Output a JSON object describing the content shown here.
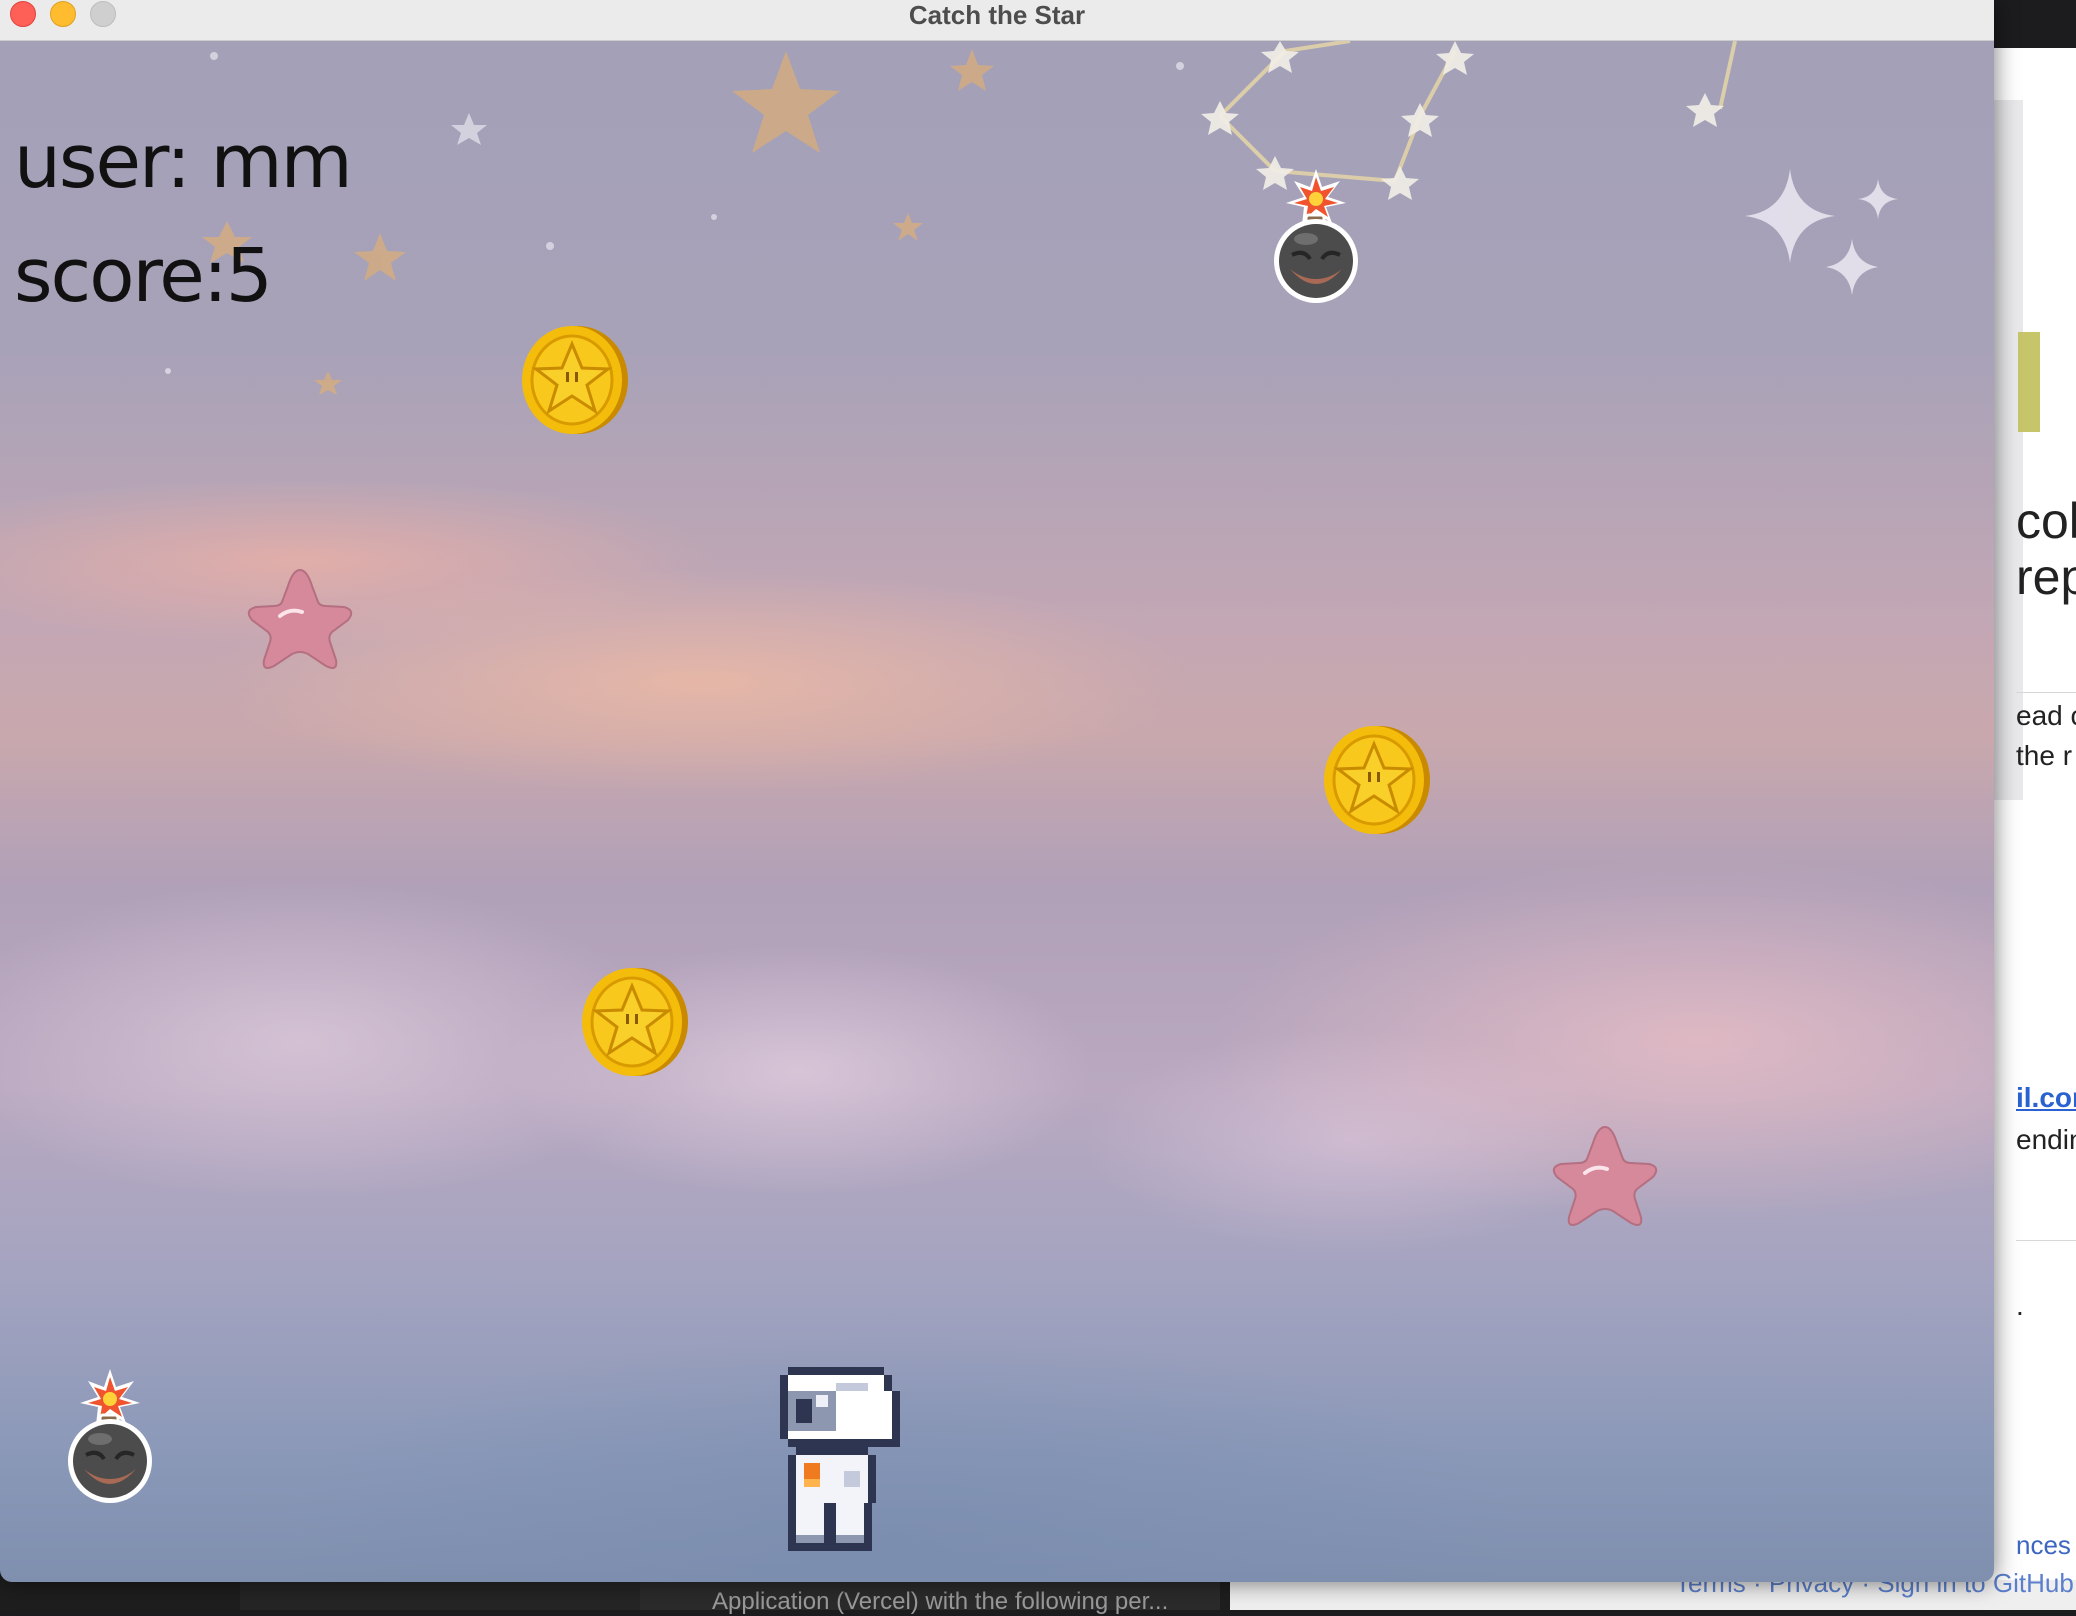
{
  "window": {
    "title": "Catch the Star"
  },
  "hud": {
    "user_text": "user: mm",
    "score_text": "score:5"
  },
  "game_objects": {
    "coins": 3,
    "pink_stars": 2,
    "bombs": 2,
    "player": "astronaut"
  },
  "background_window": {
    "fragments": [
      "coll",
      "rep",
      "ead c",
      "the r",
      "il.cor",
      "endin",
      ".",
      "nces"
    ],
    "footer_links": "Terms · Privacy · Sign in to GitHub"
  },
  "background_terminal": {
    "text": "Application (Vercel) with the following per..."
  },
  "colors": {
    "coin": "#f2b707",
    "pink_star": "#d98a9c",
    "bomb": "#4a4a4a",
    "titlebar": "#ecebeb"
  },
  "icons": [
    "close-icon",
    "minimize-icon",
    "maximize-icon",
    "coin-star-icon",
    "pink-star-icon",
    "bomb-icon",
    "astronaut-icon"
  ]
}
